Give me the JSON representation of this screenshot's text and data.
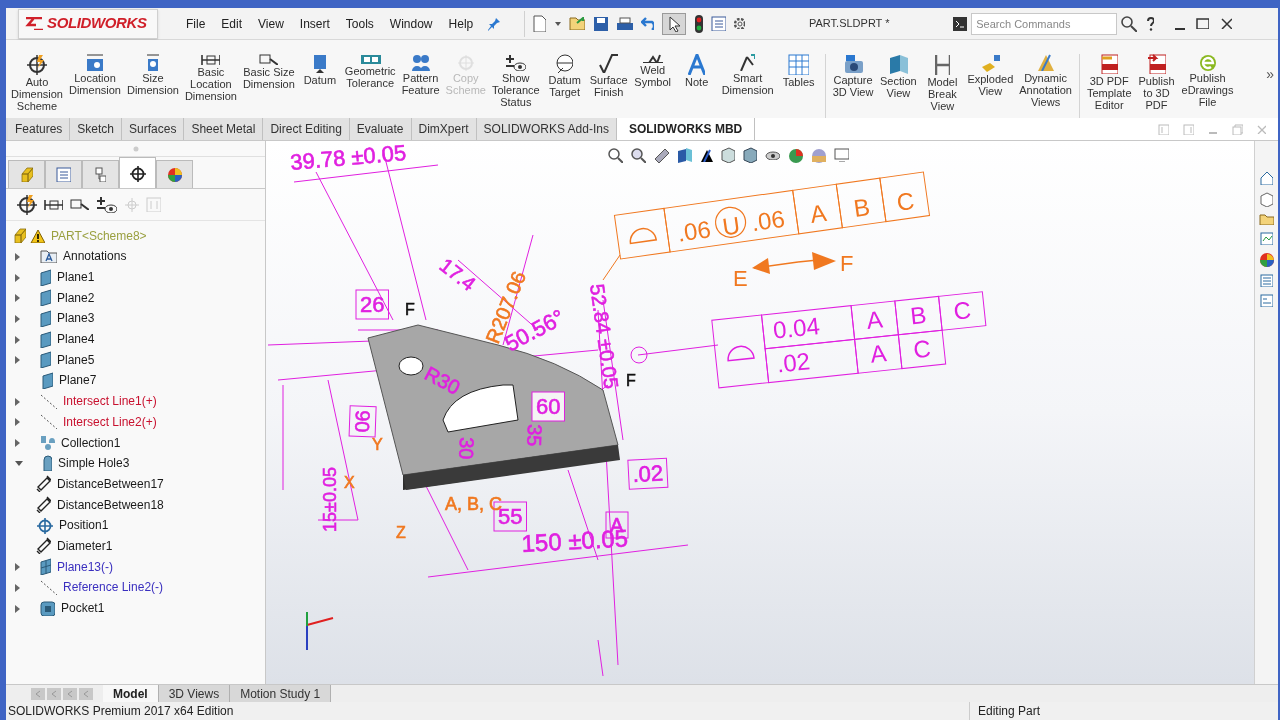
{
  "title_bar": {
    "logo": "SOLIDWORKS",
    "menu": [
      "File",
      "Edit",
      "View",
      "Insert",
      "Tools",
      "Window",
      "Help"
    ],
    "document_title": "PART.SLDPRT *",
    "search": {
      "placeholder": "Search Commands"
    }
  },
  "ribbon": {
    "groups": [
      [
        {
          "label": "Auto\nDimension\nScheme",
          "disabled": false
        },
        {
          "label": "Location\nDimension",
          "disabled": false
        },
        {
          "label": "Size\nDimension",
          "disabled": false
        },
        {
          "label": "Basic\nLocation\nDimension",
          "disabled": false
        },
        {
          "label": "Basic Size\nDimension",
          "disabled": false
        },
        {
          "label": "Datum",
          "disabled": false
        },
        {
          "label": "Geometric\nTolerance",
          "disabled": false
        },
        {
          "label": "Pattern\nFeature",
          "disabled": false
        },
        {
          "label": "Copy\nScheme",
          "disabled": true
        },
        {
          "label": "Show\nTolerance\nStatus",
          "disabled": false
        },
        {
          "label": "Datum\nTarget",
          "disabled": false
        },
        {
          "label": "Surface\nFinish",
          "disabled": false
        },
        {
          "label": "Weld\nSymbol",
          "disabled": false
        },
        {
          "label": "Note",
          "disabled": false
        },
        {
          "label": "Smart\nDimension",
          "disabled": false
        },
        {
          "label": "Tables",
          "disabled": false
        }
      ],
      [
        {
          "label": "Capture\n3D View",
          "disabled": false
        },
        {
          "label": "Section\nView",
          "disabled": false
        },
        {
          "label": "Model\nBreak\nView",
          "disabled": false
        },
        {
          "label": "Exploded\nView",
          "disabled": false
        },
        {
          "label": "Dynamic\nAnnotation\nViews",
          "disabled": false
        }
      ],
      [
        {
          "label": "3D PDF\nTemplate\nEditor",
          "disabled": false
        },
        {
          "label": "Publish\nto 3D\nPDF",
          "disabled": false
        },
        {
          "label": "Publish\neDrawings\nFile",
          "disabled": false
        }
      ]
    ],
    "more": "»"
  },
  "command_tabs": [
    {
      "label": "Features",
      "selected": false
    },
    {
      "label": "Sketch",
      "selected": false
    },
    {
      "label": "Surfaces",
      "selected": false
    },
    {
      "label": "Sheet Metal",
      "selected": false
    },
    {
      "label": "Direct Editing",
      "selected": false
    },
    {
      "label": "Evaluate",
      "selected": false
    },
    {
      "label": "DimXpert",
      "selected": false
    },
    {
      "label": "SOLIDWORKS Add-Ins",
      "selected": false
    },
    {
      "label": "SOLIDWORKS MBD",
      "selected": true
    }
  ],
  "panel_tabs": [
    {
      "selected": false
    },
    {
      "selected": false
    },
    {
      "selected": false
    },
    {
      "selected": true
    },
    {
      "selected": false
    }
  ],
  "tree": {
    "root": "PART<Scheme8>",
    "items": [
      {
        "label": "Annotations",
        "kind": "annotations",
        "color": "#1a1a1a",
        "expanded": false
      },
      {
        "label": "Plane1",
        "kind": "plane",
        "color": "#1a1a1a",
        "expanded": false
      },
      {
        "label": "Plane2",
        "kind": "plane",
        "color": "#1a1a1a",
        "expanded": false
      },
      {
        "label": "Plane3",
        "kind": "plane",
        "color": "#1a1a1a",
        "expanded": false
      },
      {
        "label": "Plane4",
        "kind": "plane",
        "color": "#1a1a1a",
        "expanded": false
      },
      {
        "label": "Plane5",
        "kind": "plane",
        "color": "#1a1a1a",
        "expanded": false
      },
      {
        "label": "Plane7",
        "kind": "plane",
        "color": "#1a1a1a"
      },
      {
        "label": "Intersect Line1(+)",
        "kind": "line",
        "color": "#c8102e",
        "expanded": false
      },
      {
        "label": "Intersect Line2(+)",
        "kind": "line",
        "color": "#c8102e",
        "expanded": false
      },
      {
        "label": "Collection1",
        "kind": "collection",
        "color": "#1a1a1a",
        "expanded": false
      },
      {
        "label": "Simple Hole3",
        "kind": "hole",
        "color": "#1a1a1a",
        "expanded": true,
        "children": [
          {
            "label": "DistanceBetween17",
            "kind": "dimension",
            "color": "#1a1a1a"
          },
          {
            "label": "DistanceBetween18",
            "kind": "dimension",
            "color": "#1a1a1a"
          },
          {
            "label": "Position1",
            "kind": "position",
            "color": "#1a1a1a"
          },
          {
            "label": "Diameter1",
            "kind": "dimension",
            "color": "#1a1a1a"
          }
        ]
      },
      {
        "label": "Plane13(-)",
        "kind": "grid-plane",
        "color": "#3a2fbf",
        "expanded": false
      },
      {
        "label": "Reference Line2(-)",
        "kind": "line",
        "color": "#3a2fbf",
        "expanded": false
      },
      {
        "label": "Pocket1",
        "kind": "pocket",
        "color": "#1a1a1a",
        "expanded": false
      }
    ]
  },
  "viewport": {
    "annotations": [
      {
        "text": "39.78 ±0.05",
        "color": "#e020e0"
      },
      {
        "text": "26",
        "color": "#e020e0"
      },
      {
        "text": "17.4",
        "color": "#e020e0"
      },
      {
        "text": "R207.06",
        "color": "#f07820"
      },
      {
        "text": "50.56°",
        "color": "#e020e0"
      },
      {
        "text": "52.84 ±0.05",
        "color": "#e020e0"
      },
      {
        "text": "R30",
        "color": "#e020e0"
      },
      {
        "text": "60",
        "color": "#e020e0"
      },
      {
        "text": "90",
        "color": "#e020e0"
      },
      {
        "text": "30",
        "color": "#e020e0"
      },
      {
        "text": "35",
        "color": "#e020e0"
      },
      {
        "text": "15±0.05",
        "color": "#e020e0"
      },
      {
        "text": "55",
        "color": "#e020e0"
      },
      {
        "text": "150 ±0.05",
        "color": "#e020e0"
      },
      {
        "text": ".02",
        "color": "#e020e0"
      },
      {
        "text": "A",
        "color": "#e020e0"
      },
      {
        "text": "A, B, C",
        "color": "#f07820"
      },
      {
        "text": "X",
        "color": "#f07820"
      },
      {
        "text": "Y",
        "color": "#f07820"
      },
      {
        "text": "Z",
        "color": "#f07820"
      },
      {
        "text": "F",
        "color": "#111111"
      },
      {
        "text": "F",
        "color": "#111111"
      }
    ],
    "frames": [
      {
        "color": "#f07820",
        "rows": [
          {
            "tolerance": [
              {
                "text": ".06",
                "circled": false
              },
              {
                "text": "U",
                "circled": true
              },
              {
                "text": ".06",
                "circled": false
              }
            ],
            "datums": [
              "A",
              "B",
              "C"
            ]
          }
        ],
        "between": {
          "from": "E",
          "to": "F"
        }
      },
      {
        "color": "#e020e0",
        "rows": [
          {
            "tolerance": [
              {
                "text": "0.04",
                "circled": false
              }
            ],
            "datums": [
              "A",
              "B",
              "C"
            ]
          },
          {
            "tolerance": [
              {
                "text": ".02",
                "circled": false
              }
            ],
            "datums": [
              "A",
              "C"
            ]
          }
        ]
      }
    ]
  },
  "bottom_tabs": [
    {
      "label": "Model",
      "selected": true
    },
    {
      "label": "3D Views",
      "selected": false
    },
    {
      "label": "Motion Study 1",
      "selected": false
    }
  ],
  "status_bar": {
    "edition": "SOLIDWORKS Premium 2017 x64 Edition",
    "mode": "Editing Part"
  }
}
